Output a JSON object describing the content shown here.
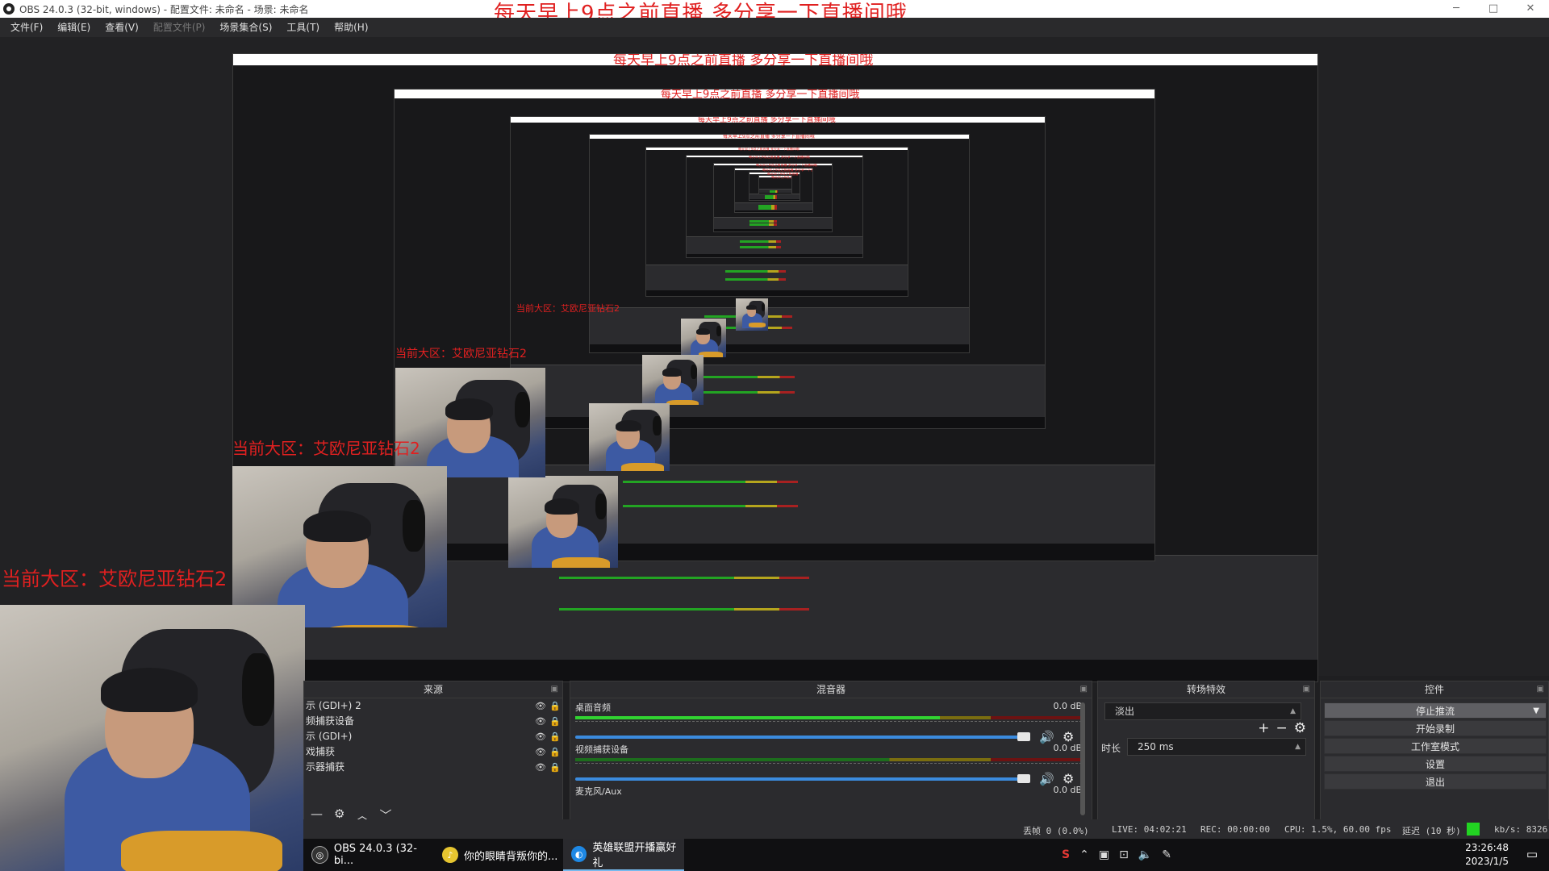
{
  "window": {
    "title": "OBS 24.0.3 (32-bit, windows) - 配置文件: 未命名 - 场景: 未命名",
    "overlay_text": "每天早上9点之前直播    多分享一下直播间哦",
    "controls": {
      "minimize": "─",
      "maximize": "□",
      "close": "✕"
    }
  },
  "menu": {
    "file": "文件(F)",
    "edit": "编辑(E)",
    "view": "查看(V)",
    "profile": "配置文件(P)",
    "scene_collection": "场景集合(S)",
    "tools": "工具(T)",
    "help": "帮助(H)"
  },
  "preview": {
    "webcam_label": "当前大区：艾欧尼亚钻石2"
  },
  "sources": {
    "title": "来源",
    "items": [
      {
        "name": "示 (GDI+) 2"
      },
      {
        "name": "频捕获设备"
      },
      {
        "name": "示 (GDI+)"
      },
      {
        "name": "戏捕获"
      },
      {
        "name": "示器捕获"
      }
    ]
  },
  "mixer": {
    "title": "混音器",
    "channels": [
      {
        "name": "桌面音频",
        "db": "0.0 dB",
        "level": 0.72
      },
      {
        "name": "视频捕获设备",
        "db": "0.0 dB",
        "level": 0.0
      },
      {
        "name": "麦克风/Aux",
        "db": "0.0 dB",
        "level": 0.0
      }
    ]
  },
  "transitions": {
    "title": "转场特效",
    "selected": "淡出",
    "duration_label": "时长",
    "duration_value": "250 ms",
    "add": "+",
    "remove": "−",
    "settings": "⚙"
  },
  "controls": {
    "title": "控件",
    "stop_stream": "停止推流",
    "start_record": "开始录制",
    "studio_mode": "工作室模式",
    "settings": "设置",
    "exit": "退出"
  },
  "status": {
    "dropped": "丢帧 0 (0.0%)",
    "live": "LIVE: 04:02:21",
    "rec": "REC: 00:00:00",
    "cpu": "CPU: 1.5%, 60.00 fps",
    "delay": "延迟 (10 秒)",
    "kbps": "kb/s: 8326"
  },
  "taskbar": {
    "apps": [
      {
        "label": "OBS 24.0.3 (32-bi..."
      },
      {
        "label": "你的眼睛背叛你的..."
      },
      {
        "label": "英雄联盟开播赢好礼"
      }
    ],
    "time": "23:26:48",
    "date": "2023/1/5"
  },
  "colors": {
    "overlay_text": "#e02020",
    "meter_green": "#31d331",
    "slider_blue": "#3b8bde",
    "delay_indicator": "#22d422",
    "taskbar_active": "#76b9ed"
  }
}
